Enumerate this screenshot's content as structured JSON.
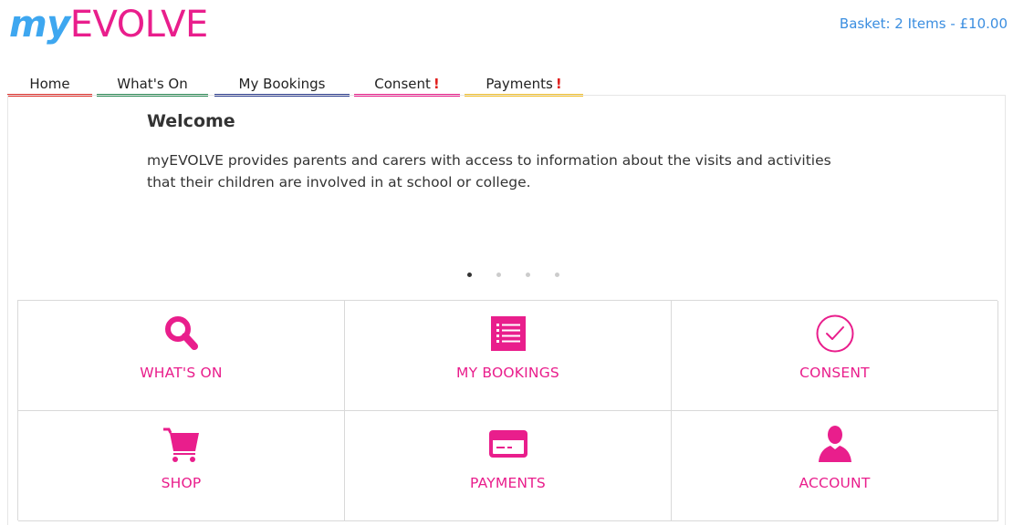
{
  "header": {
    "logo_my": "my",
    "logo_evolve": "EVOLVE",
    "basket": "Basket: 2 Items - £10.00"
  },
  "nav": {
    "tabs": [
      {
        "label": "Home",
        "alert": "",
        "color": "#e0322e"
      },
      {
        "label": "What's On",
        "alert": "",
        "color": "#2e8b57"
      },
      {
        "label": "My Bookings",
        "alert": "",
        "color": "#2e3e8f"
      },
      {
        "label": "Consent",
        "alert": "!",
        "color": "#e91e8c"
      },
      {
        "label": "Payments",
        "alert": "!",
        "color": "#f2c12e"
      }
    ]
  },
  "welcome": {
    "title": "Welcome",
    "text": "myEVOLVE provides parents and carers with access to information about the visits and activities that their children are involved in at school or college."
  },
  "carousel": {
    "slide_count": 4,
    "active_index": 0
  },
  "tiles": [
    {
      "label": "WHAT'S ON",
      "icon": "search-icon"
    },
    {
      "label": "MY BOOKINGS",
      "icon": "list-icon"
    },
    {
      "label": "CONSENT",
      "icon": "check-circle-icon"
    },
    {
      "label": "SHOP",
      "icon": "cart-icon"
    },
    {
      "label": "PAYMENTS",
      "icon": "credit-card-icon"
    },
    {
      "label": "ACCOUNT",
      "icon": "user-icon"
    }
  ],
  "colors": {
    "brand_pink": "#e91e8c",
    "brand_blue": "#3ea7f0",
    "link_blue": "#3b8ee0"
  }
}
